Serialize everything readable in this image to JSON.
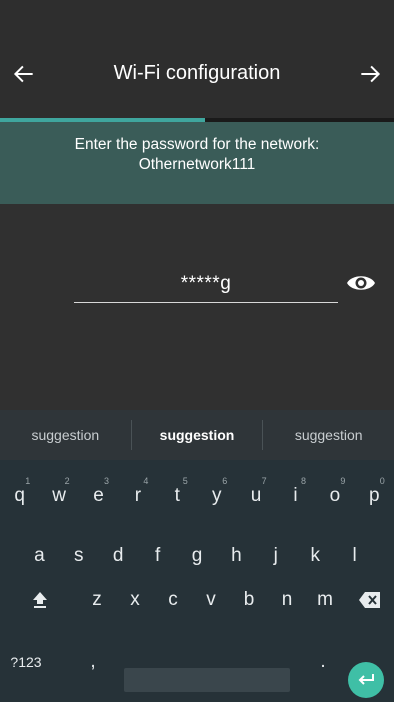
{
  "header": {
    "title": "Wi-Fi configuration",
    "back_icon": "arrow-left-icon",
    "forward_icon": "arrow-right-icon"
  },
  "progress": {
    "fraction": 0.52,
    "color": "#3fa69e"
  },
  "banner": {
    "line1": "Enter the password for the network:",
    "line2": "Othernetwork111"
  },
  "password": {
    "value": "*****g",
    "toggle_icon": "eye-icon"
  },
  "suggestions": [
    "suggestion",
    "suggestion",
    "suggestion"
  ],
  "keyboard": {
    "row1": [
      {
        "k": "q",
        "n": "1"
      },
      {
        "k": "w",
        "n": "2"
      },
      {
        "k": "e",
        "n": "3"
      },
      {
        "k": "r",
        "n": "4"
      },
      {
        "k": "t",
        "n": "5"
      },
      {
        "k": "y",
        "n": "6"
      },
      {
        "k": "u",
        "n": "7"
      },
      {
        "k": "i",
        "n": "8"
      },
      {
        "k": "o",
        "n": "9"
      },
      {
        "k": "p",
        "n": "0"
      }
    ],
    "row2": [
      "a",
      "s",
      "d",
      "f",
      "g",
      "h",
      "j",
      "k",
      "l"
    ],
    "row3": [
      "z",
      "x",
      "c",
      "v",
      "b",
      "n",
      "m"
    ],
    "symbols_label": "?123",
    "comma": ",",
    "period": ".",
    "shift_icon": "shift-icon",
    "backspace_icon": "backspace-icon",
    "enter_icon": "enter-icon"
  }
}
